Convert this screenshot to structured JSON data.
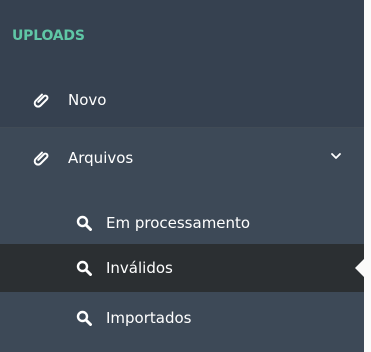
{
  "sidebar": {
    "section_title": "UPLOADS",
    "colors": {
      "background": "#364150",
      "section_title": "#5fc7a6",
      "expanded_bg": "#3d4957",
      "active_bg": "#2b2f32",
      "text": "#ffffff",
      "page_bg": "#fafafa"
    },
    "items": [
      {
        "label": "Novo",
        "icon": "paperclip-icon"
      },
      {
        "label": "Arquivos",
        "icon": "paperclip-icon",
        "expanded": true,
        "toggle_icon": "chevron-down-icon"
      }
    ],
    "subitems": [
      {
        "label": "Em processamento",
        "icon": "search-icon"
      },
      {
        "label": "Inválidos",
        "icon": "search-icon",
        "active": true
      },
      {
        "label": "Importados",
        "icon": "search-icon"
      }
    ]
  }
}
